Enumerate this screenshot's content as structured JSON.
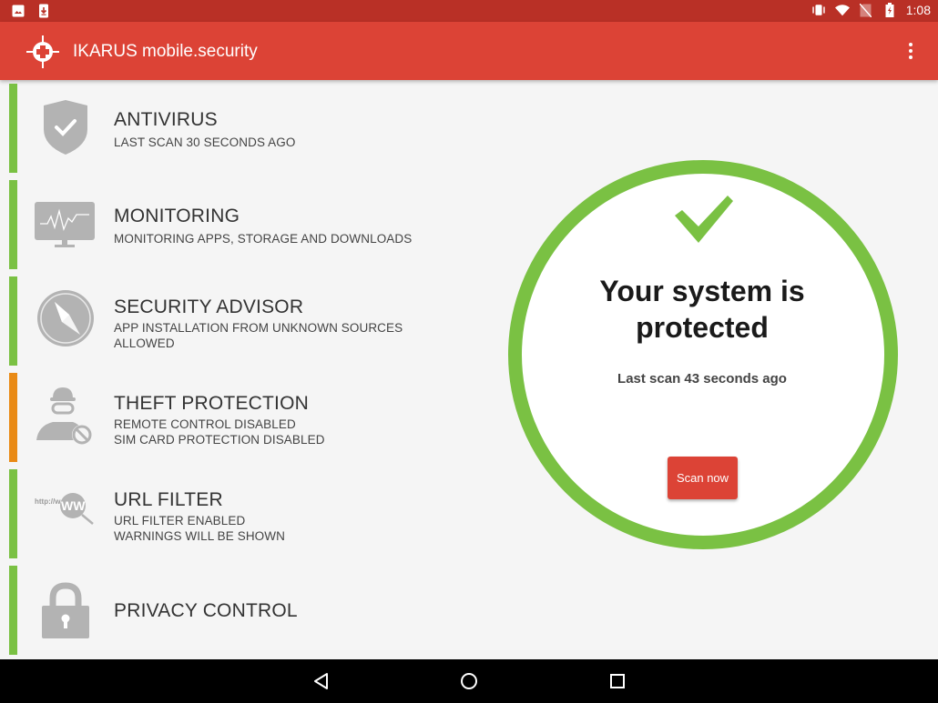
{
  "status_bar": {
    "left_icons": [
      "image-notification-icon",
      "download-notification-icon"
    ],
    "right_icons": [
      "vibrate-icon",
      "wifi-icon",
      "no-sim-icon",
      "battery-charging-icon"
    ],
    "time": "1:08"
  },
  "app_bar": {
    "title": "IKARUS mobile.security",
    "logo_icon": "ikarus-crosshair-icon",
    "menu_icon": "more-vert-icon"
  },
  "modules": [
    {
      "id": "antivirus",
      "title": "ANTIVIRUS",
      "lines": [
        "LAST SCAN 30 SECONDS AGO"
      ],
      "status_color": "#7ac143",
      "icon": "shield-check-icon"
    },
    {
      "id": "monitoring",
      "title": "MONITORING",
      "lines": [
        "MONITORING APPS, STORAGE AND DOWNLOADS"
      ],
      "status_color": "#7ac143",
      "icon": "monitor-pulse-icon"
    },
    {
      "id": "security-advisor",
      "title": "SECURITY ADVISOR",
      "lines": [
        "APP INSTALLATION FROM UNKNOWN SOURCES",
        "ALLOWED"
      ],
      "status_color": "#7ac143",
      "icon": "compass-icon"
    },
    {
      "id": "theft-protection",
      "title": "THEFT PROTECTION",
      "lines": [
        "REMOTE CONTROL DISABLED",
        "SIM CARD PROTECTION DISABLED"
      ],
      "status_color": "#e98a15",
      "icon": "thief-blocked-icon"
    },
    {
      "id": "url-filter",
      "title": "URL FILTER",
      "lines": [
        "URL FILTER ENABLED",
        "WARNINGS WILL BE SHOWN"
      ],
      "status_color": "#7ac143",
      "icon": "www-search-icon",
      "icon_text": "http://w",
      "icon_badge": "WW"
    },
    {
      "id": "privacy-control",
      "title": "PRIVACY CONTROL",
      "lines": [],
      "status_color": "#7ac143",
      "icon": "padlock-icon"
    }
  ],
  "status_panel": {
    "headline": "Your system is protected",
    "last_scan": "Last scan 43 seconds ago",
    "scan_button": "Scan now",
    "ring_color": "#7ac143"
  },
  "colors": {
    "brand_red": "#dc4336",
    "status_bar_red": "#b93026",
    "ok_green": "#7ac143",
    "warn_orange": "#e98a15",
    "icon_gray": "#b3b3b3"
  },
  "nav_bar": {
    "buttons": [
      "back-icon",
      "home-icon",
      "recents-icon"
    ]
  }
}
